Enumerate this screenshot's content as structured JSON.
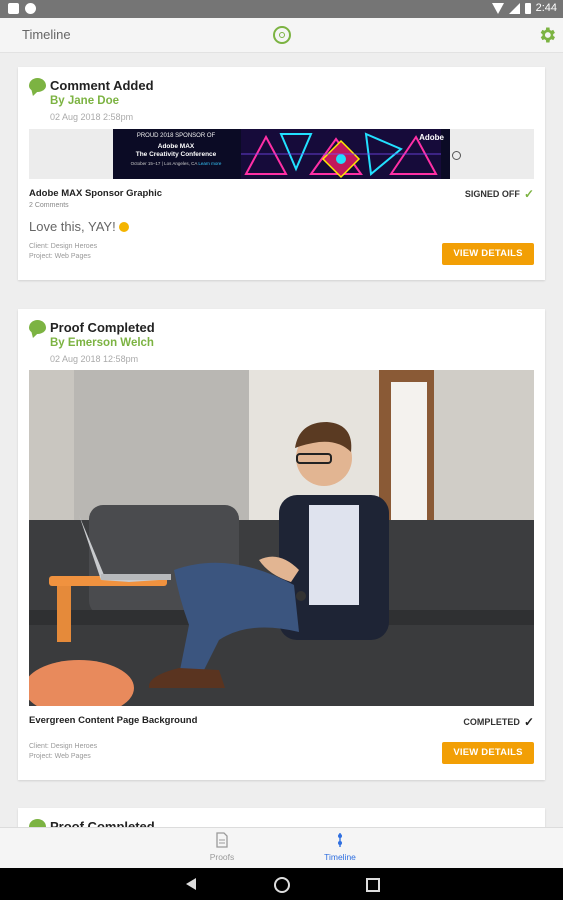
{
  "status_bar": {
    "time": "2:44"
  },
  "app_bar": {
    "title": "Timeline"
  },
  "cards": [
    {
      "title": "Comment Added",
      "by": "By Jane Doe",
      "date": "02 Aug 2018 2:58pm",
      "banner": {
        "line1": "PROUD 2018 SPONSOR OF",
        "line2": "Adobe MAX",
        "line3": "The Creativity Conference",
        "line4": "October 15–17 | Los Angeles, CA",
        "line5": "Learn more",
        "brand": "Adobe"
      },
      "asset_name": "Adobe MAX Sponsor Graphic",
      "comments_count": "2 Comments",
      "status": "SIGNED OFF",
      "comment": "Love this, YAY!",
      "client": "Client: Design Heroes",
      "project": "Project: Web Pages",
      "button": "VIEW DETAILS"
    },
    {
      "title": "Proof Completed",
      "by": "By Emerson Welch",
      "date": "02 Aug 2018 12:58pm",
      "asset_name": "Evergreen Content Page Background",
      "status": "COMPLETED",
      "client": "Client: Design Heroes",
      "project": "Project: Web Pages",
      "button": "VIEW DETAILS"
    },
    {
      "title": "Proof Completed"
    }
  ],
  "bottom_nav": [
    {
      "label": "Proofs",
      "icon": "document-icon"
    },
    {
      "label": "Timeline",
      "icon": "timeline-icon"
    }
  ],
  "colors": {
    "brand_green": "#7cb342",
    "action_orange": "#f29f05",
    "active_blue": "#2f6fe0"
  }
}
